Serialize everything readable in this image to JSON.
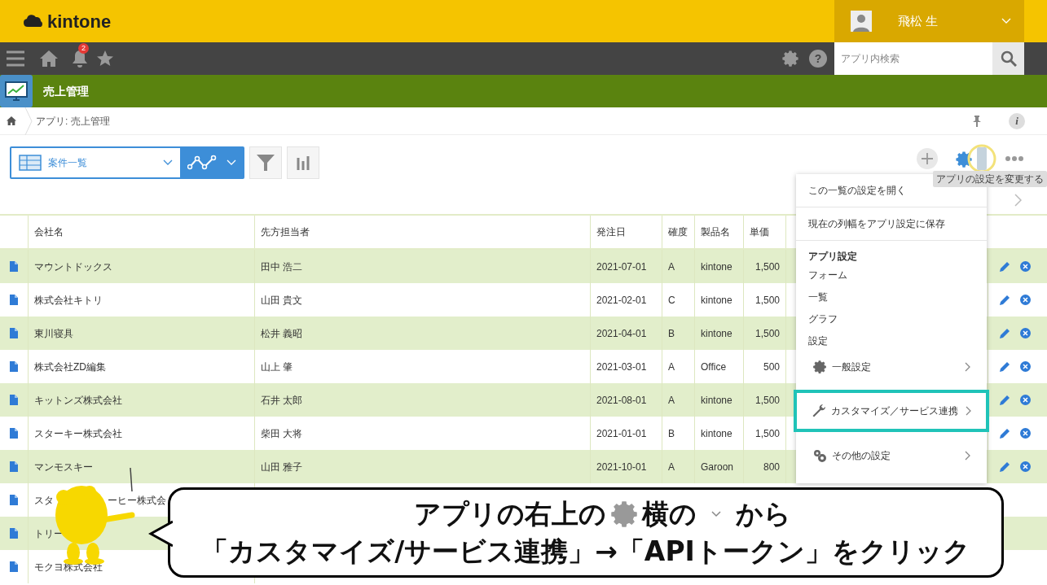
{
  "header": {
    "logo": "kintone",
    "user": "飛松 生"
  },
  "nav": {
    "notification_count": "2",
    "help": "?",
    "search": {
      "placeholder": "アプリ内検索"
    }
  },
  "app": {
    "title": "売上管理",
    "breadcrumb": "アプリ: 売上管理",
    "info": "i"
  },
  "toolbar": {
    "view": "案件一覧",
    "tooltip": "アプリの設定を変更する"
  },
  "table": {
    "columns": [
      "会社名",
      "先方担当者",
      "発注日",
      "確度",
      "製品名",
      "単価"
    ],
    "rows": [
      {
        "company": [
          "マウントドックス"
        ],
        "contact": "田中 浩二",
        "date": "2021-07-01",
        "rank": "A",
        "product": "kintone",
        "price": "1,500"
      },
      {
        "company": [
          "株式会社キトリ"
        ],
        "contact": "山田 貴文",
        "date": "2021-02-01",
        "rank": "C",
        "product": "kintone",
        "price": "1,500"
      },
      {
        "company": [
          "東川寝具"
        ],
        "contact": "松井 義昭",
        "date": "2021-04-01",
        "rank": "B",
        "product": "kintone",
        "price": "1,500"
      },
      {
        "company": [
          "株式会社ZD編集"
        ],
        "contact": "山上 肇",
        "date": "2021-03-01",
        "rank": "A",
        "product": "Office",
        "price": "500"
      },
      {
        "company": [
          "キットンズ株式会社"
        ],
        "contact": "石井 太郎",
        "date": "2021-08-01",
        "rank": "A",
        "product": "kintone",
        "price": "1,500"
      },
      {
        "company": [
          "スターキー株式会社"
        ],
        "contact": "柴田 大将",
        "date": "2021-01-01",
        "rank": "B",
        "product": "kintone",
        "price": "1,500"
      },
      {
        "company": [
          "マンモスキー"
        ],
        "contact": "山田 雅子",
        "date": "2021-10-01",
        "rank": "A",
        "product": "Garoon",
        "price": "800"
      },
      {
        "company": [
          "スタ",
          "ーヒー株式会"
        ]
      },
      {
        "company": [
          "トリー"
        ]
      },
      {
        "company": [
          "モクヨ株式会社"
        ]
      }
    ]
  },
  "menu": {
    "items": [
      {
        "kind": "action",
        "label": "この一覧の設定を開く"
      },
      {
        "kind": "action",
        "label": "現在の列幅をアプリ設定に保存"
      },
      {
        "kind": "heading",
        "label": "アプリ設定"
      },
      {
        "kind": "link",
        "label": "フォーム"
      },
      {
        "kind": "link",
        "label": "一覧"
      },
      {
        "kind": "link",
        "label": "グラフ"
      },
      {
        "kind": "link",
        "label": "設定"
      },
      {
        "kind": "sub",
        "label": "一般設定",
        "selected": false
      },
      {
        "kind": "sub",
        "label": "カスタマイズ／サービス連携",
        "selected": true
      },
      {
        "kind": "sub",
        "label": "その他の設定",
        "selected": false
      }
    ]
  },
  "caption": {
    "line1": [
      "アプリの右上の",
      "横の",
      "から"
    ],
    "line2": "「カスタマイズ/サービス連携」→「APIトークン」をクリック"
  }
}
